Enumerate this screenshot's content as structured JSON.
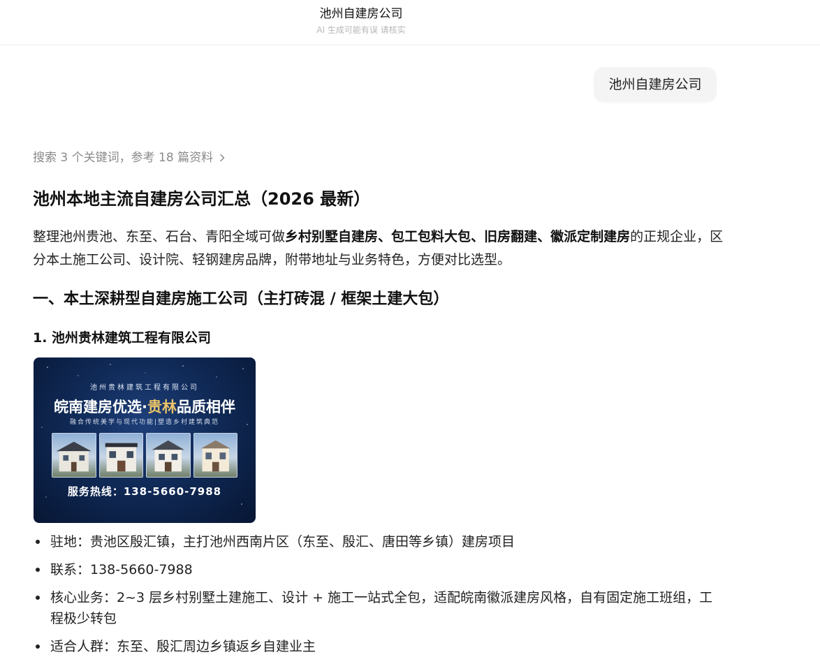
{
  "header": {
    "title": "池州自建房公司",
    "subtitle": "AI 生成可能有误 请核实"
  },
  "user_message": "池州自建房公司",
  "search_summary": "搜索 3 个关键词，参考 18 篇资料",
  "answer": {
    "title": "池州本地主流自建房公司汇总（2026 最新）",
    "intro": {
      "prefix": "整理池州贵池、东至、石台、青阳全域可做",
      "bold1": "乡村别墅自建房",
      "sep1": "、",
      "bold2": "包工包料大包",
      "sep2": "、",
      "bold3": "旧房翻建",
      "sep3": "、",
      "bold4": "徽派定制建房",
      "suffix": "的正规企业，区分本土施工公司、设计院、轻钢建房品牌，附带地址与业务特色，方便对比选型。"
    },
    "section1_heading": "一、本土深耕型自建房施工公司（主打砖混 / 框架土建大包）",
    "company1_heading": "1. 池州贵林建筑工程有限公司",
    "banner": {
      "company": "池州贵林建筑工程有限公司",
      "title_white1": "皖南建房优选·",
      "title_gold": "贵林",
      "title_white2": "品质相伴",
      "subtitle": "融合传统美学与现代功能|塑造乡村建筑典范",
      "hotline": "服务热线：138-5660-7988"
    },
    "company1_details": [
      "驻地：贵池区殷汇镇，主打池州西南片区（东至、殷汇、唐田等乡镇）建房项目",
      "联系：138-5660-7988",
      "核心业务：2~3 层乡村别墅土建施工、设计 + 施工一站式全包，适配皖南徽派建房风格，自有固定施工班组，工程极少转包",
      "适合人群：东至、殷汇周边乡镇返乡自建业主"
    ]
  },
  "colors": {
    "text": "#111111",
    "muted": "#8a8a8a",
    "bubble_bg": "#f4f4f5",
    "banner_bg": "#102a57",
    "banner_gold": "#e9c36a"
  },
  "icons": {
    "search_summary_arrow": "chevron-right-icon",
    "list_bullet": "bullet-dot-icon"
  }
}
